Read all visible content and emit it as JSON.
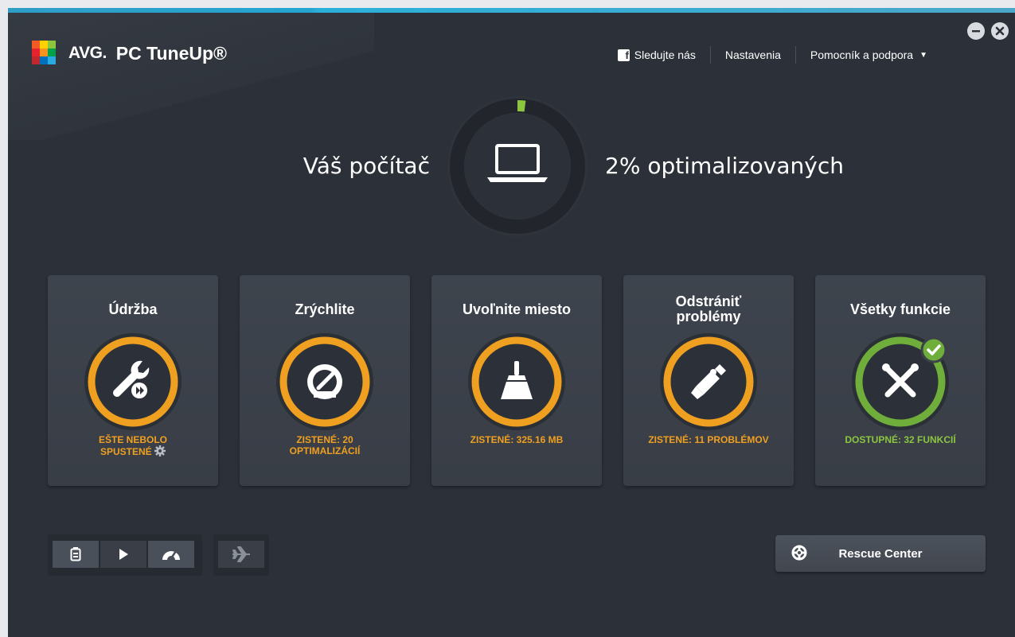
{
  "header": {
    "brand": "AVG.",
    "product": "PC TuneUp®",
    "nav": [
      {
        "label": "Sledujte nás",
        "icon": "facebook-icon"
      },
      {
        "label": "Nastavenia"
      },
      {
        "label": "Pomocník a podpora",
        "icon": "caret-down-icon"
      }
    ],
    "window_controls": [
      "minimize-icon",
      "close-icon"
    ]
  },
  "hero": {
    "left_text": "Váš počítač",
    "right_text": "2% optimalizovaných",
    "optimized_fraction": 0.02,
    "icon": "laptop-icon",
    "progress_color": "#8cc63f"
  },
  "tiles": [
    {
      "title": "Údržba",
      "icon": "wrench-play-icon",
      "status_lines": [
        "EŠTE NEBOLO",
        "SPUSTENÉ"
      ],
      "status_icon": "gear-icon",
      "color": "#f0a020"
    },
    {
      "title": "Zrýchlite",
      "icon": "speedometer-icon",
      "status_lines": [
        "ZISTENÉ: 20",
        "OPTIMALIZÁCIÍ"
      ],
      "color": "#f0a020"
    },
    {
      "title": "Uvoľnite miesto",
      "icon": "broom-icon",
      "status_lines": [
        "ZISTENÉ: 325.16 MB"
      ],
      "color": "#f0a020"
    },
    {
      "title": "Odstrániť problémy",
      "icon": "tools-icon",
      "status_lines": [
        "ZISTENÉ: 11 PROBLÉMOV"
      ],
      "color": "#f0a020"
    },
    {
      "title": "Všetky funkcie",
      "icon": "crossed-tools-icon",
      "status_lines": [
        "DOSTUPNÉ: 32 FUNKCIÍ"
      ],
      "color": "#8cc63f",
      "badge": "check-icon"
    }
  ],
  "footer": {
    "modes": [
      {
        "icon": "battery-icon"
      },
      {
        "icon": "play-icon",
        "active": true
      },
      {
        "icon": "turbo-gauge-icon"
      }
    ],
    "airplane": {
      "icon": "airplane-icon"
    },
    "rescue": {
      "label": "Rescue Center",
      "icon": "lifebuoy-icon"
    }
  },
  "colors": {
    "background": "#2c3139",
    "tile": "#3b4049",
    "orange": "#f0a020",
    "green": "#8cc63f",
    "accent_stripe": "#24a4d0"
  }
}
